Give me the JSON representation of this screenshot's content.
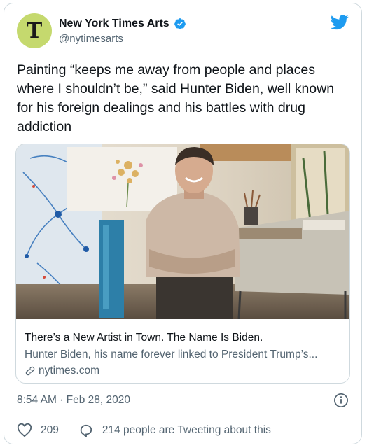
{
  "tweet": {
    "avatar_letter": "T",
    "display_name": "New York Times Arts",
    "handle": "@nytimesarts",
    "text": "Painting “keeps me away from people and places where I shouldn’t be,” said Hunter Biden, well known for his foreign dealings and his battles with drug addiction",
    "timestamp": "8:54 AM · Feb 28, 2020",
    "likes": "209",
    "conversation": "214 people are Tweeting about this"
  },
  "link_card": {
    "title": "There’s a New Artist in Town. The Name Is Biden.",
    "description": "Hunter Biden, his name forever linked to President Trump’s...",
    "domain": "nytimes.com"
  },
  "icons": {
    "verified": "verified-badge-icon",
    "brand": "twitter-bird-icon",
    "link": "link-icon",
    "info": "info-icon",
    "like": "heart-icon",
    "reply": "speech-bubble-icon"
  },
  "colors": {
    "twitter_blue": "#1d9bf0",
    "avatar_bg": "#c5d96e",
    "secondary_text": "#536471",
    "border": "#cfd9de"
  }
}
